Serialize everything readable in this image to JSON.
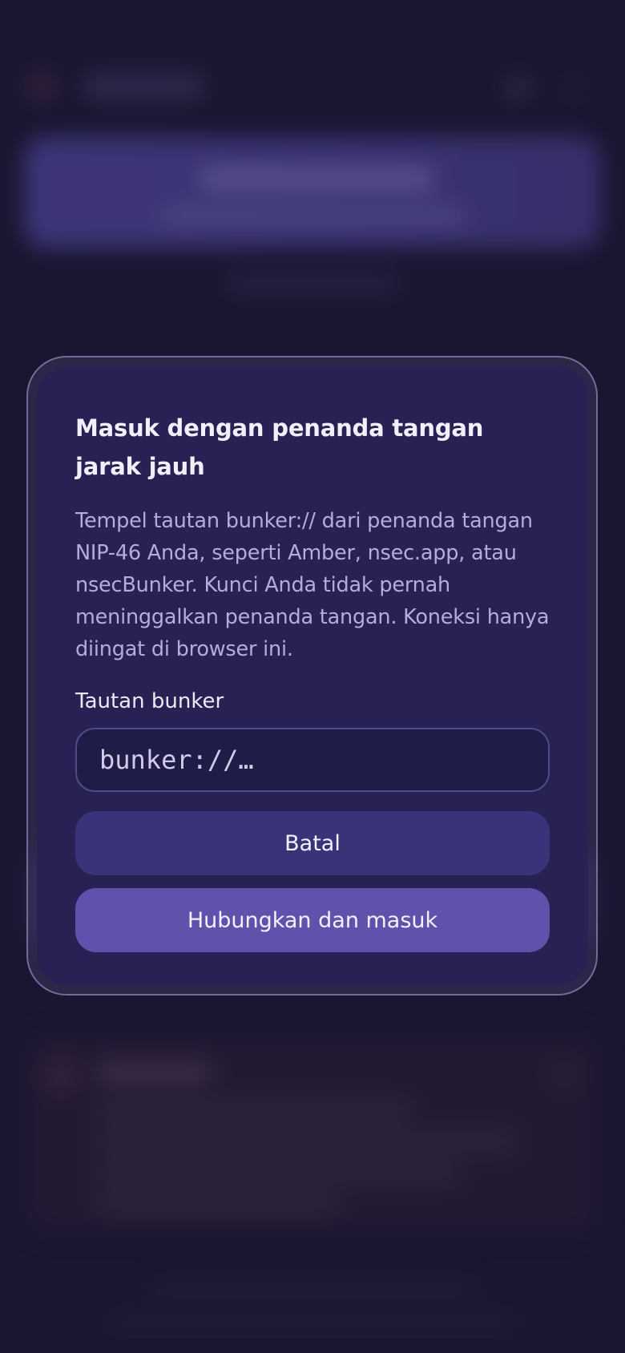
{
  "dialog": {
    "title": "Masuk dengan penanda tangan jarak jauh",
    "description": "Tempel tautan bunker:// dari penanda tangan NIP-46 Anda, seperti Amber, nsec.app, atau nsecBunker. Kunci Anda tidak pernah meninggalkan penanda tangan. Koneksi hanya diingat di browser ini.",
    "field_label": "Tautan bunker",
    "input": {
      "value": "",
      "placeholder": "bunker://…"
    },
    "cancel_label": "Batal",
    "connect_label": "Hubungkan dan masuk"
  },
  "colors": {
    "background": "#1c1936",
    "dialog": "#272253",
    "cancel_button": "#3b3379",
    "connect_button": "#5e52ad",
    "banner": "#5a4fb0"
  }
}
